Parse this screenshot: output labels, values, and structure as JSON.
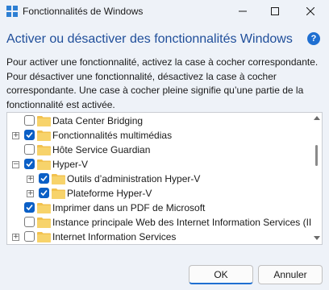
{
  "window": {
    "title": "Fonctionnalités de Windows"
  },
  "header": {
    "heading": "Activer ou désactiver des fonctionnalités Windows",
    "help_icon": "?"
  },
  "description": "Pour activer une fonctionnalité, activez la case à cocher correspondante. Pour désactiver une fonctionnalité, désactivez la case à cocher correspondante. Une case à cocher pleine signifie qu’une partie de la fonctionnalité est activée.",
  "features": [
    {
      "label": "Data Center Bridging",
      "checked": false,
      "expander": "",
      "indent": 0
    },
    {
      "label": "Fonctionnalités multimédias",
      "checked": true,
      "expander": "+",
      "indent": 0
    },
    {
      "label": "Hôte Service Guardian",
      "checked": false,
      "expander": "",
      "indent": 0
    },
    {
      "label": "Hyper-V",
      "checked": true,
      "expander": "-",
      "indent": 0
    },
    {
      "label": "Outils d’administration Hyper-V",
      "checked": true,
      "expander": "+",
      "indent": 1
    },
    {
      "label": "Plateforme Hyper-V",
      "checked": true,
      "expander": "+",
      "indent": 1
    },
    {
      "label": "Imprimer dans un PDF de Microsoft",
      "checked": true,
      "expander": "",
      "indent": 0
    },
    {
      "label": "Instance principale Web des Internet Information Services (IIS)",
      "checked": false,
      "expander": "",
      "indent": 0
    },
    {
      "label": "Internet Information Services",
      "checked": false,
      "expander": "+",
      "indent": 0
    }
  ],
  "buttons": {
    "ok": "OK",
    "cancel": "Annuler"
  },
  "colors": {
    "accent": "#0a5fc6",
    "heading": "#1f4e9a",
    "folder": "#f2c14e"
  }
}
